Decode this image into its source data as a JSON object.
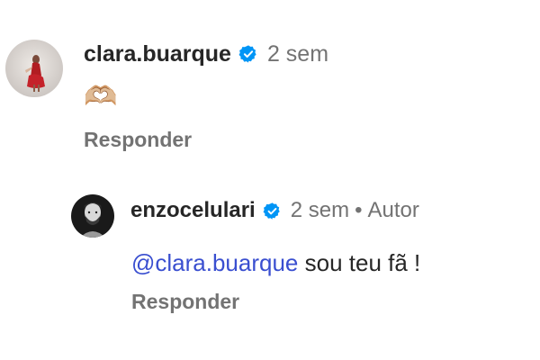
{
  "comments": [
    {
      "username": "clara.buarque",
      "time": "2 sem",
      "body_emoji": "🫶🏼",
      "reply_label": "Responder",
      "avatar_icon": "profile-photo-red-dress",
      "verified_icon": "verified-badge-icon"
    },
    {
      "username": "enzocelulari",
      "time": "2 sem",
      "separator": "•",
      "author_label": "Autor",
      "mention": "@clara.buarque",
      "body_text": " sou teu fã !",
      "reply_label": "Responder",
      "avatar_icon": "profile-photo-bearded-man",
      "verified_icon": "verified-badge-icon"
    }
  ],
  "colors": {
    "text": "#262626",
    "secondary": "#737373",
    "mention": "#3a4fd0",
    "verified": "#0095f6"
  }
}
